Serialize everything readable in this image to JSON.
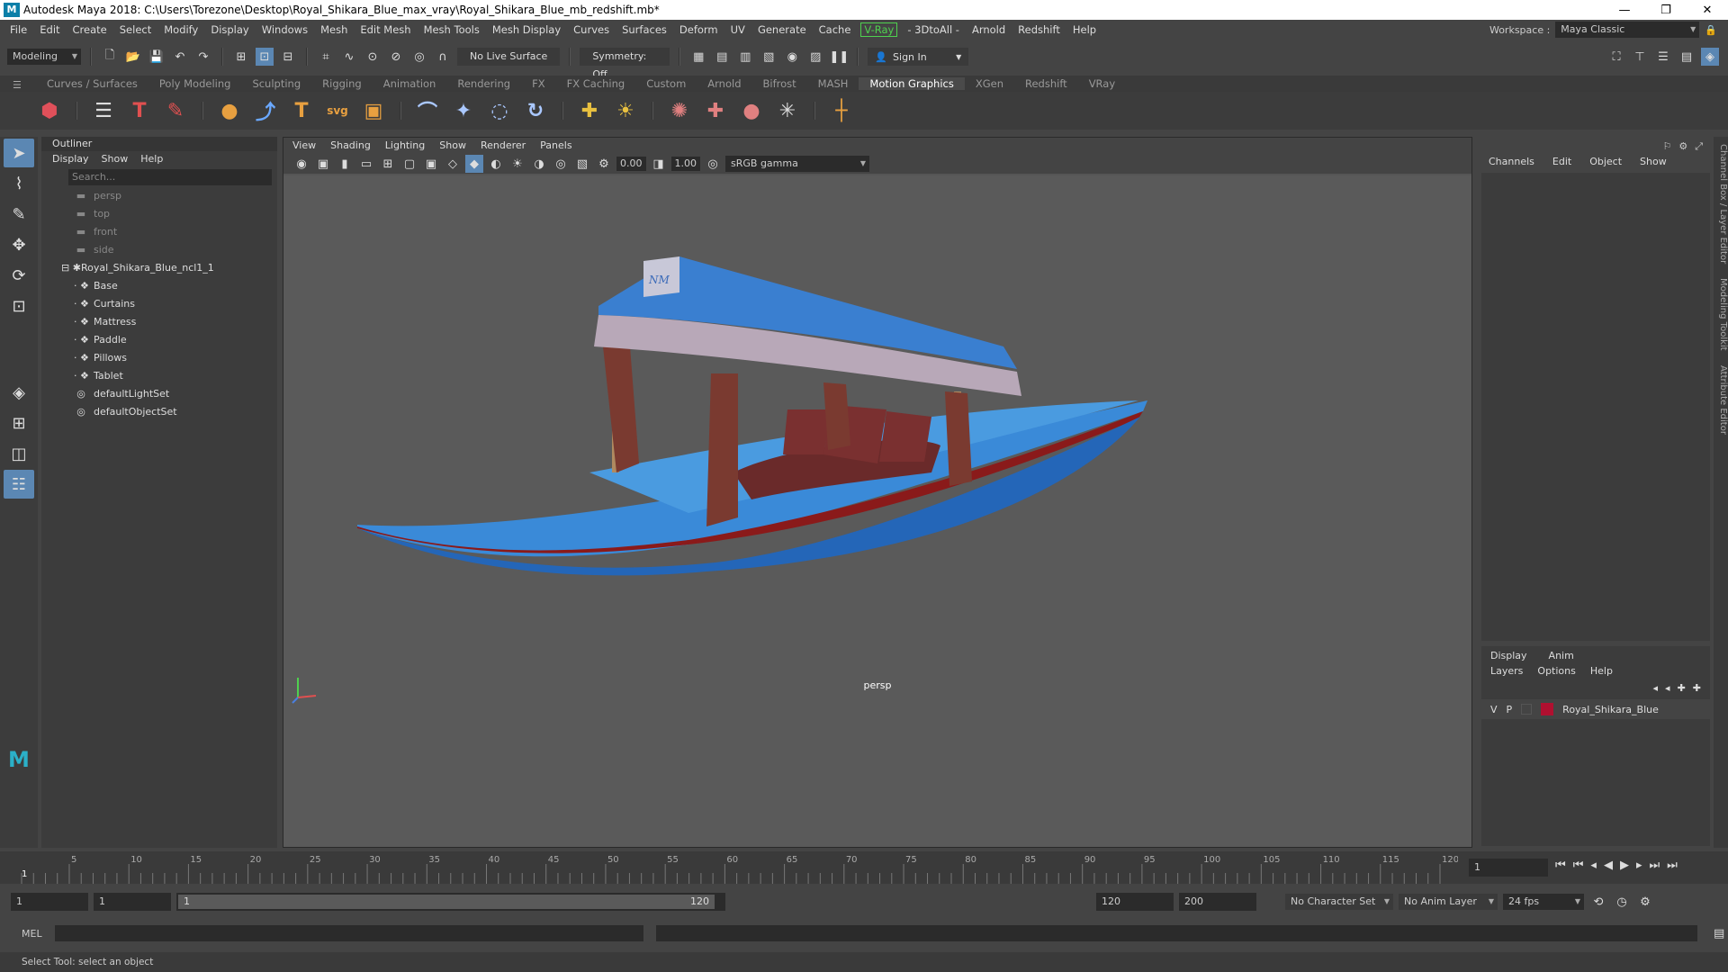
{
  "window": {
    "title": "Autodesk Maya 2018: C:\\Users\\Torezone\\Desktop\\Royal_Shikara_Blue_max_vray\\Royal_Shikara_Blue_mb_redshift.mb*"
  },
  "menubar": {
    "items": [
      "File",
      "Edit",
      "Create",
      "Select",
      "Modify",
      "Display",
      "Windows",
      "Mesh",
      "Edit Mesh",
      "Mesh Tools",
      "Mesh Display",
      "Curves",
      "Surfaces",
      "Deform",
      "UV",
      "Generate",
      "Cache"
    ],
    "vray": "V-Ray",
    "items2": [
      "- 3DtoAll -",
      "Arnold",
      "Redshift",
      "Help"
    ],
    "workspace_label": "Workspace :",
    "workspace_value": "Maya Classic"
  },
  "statusline": {
    "mode": "Modeling",
    "live_surface": "No Live Surface",
    "symmetry": "Symmetry: Off",
    "sign_in": "Sign In"
  },
  "shelf": {
    "tabs": [
      "Curves / Surfaces",
      "Poly Modeling",
      "Sculpting",
      "Rigging",
      "Animation",
      "Rendering",
      "FX",
      "FX Caching",
      "Custom",
      "Arnold",
      "Bifrost",
      "MASH",
      "Motion Graphics",
      "XGen",
      "Redshift",
      "VRay"
    ],
    "active_tab": "Motion Graphics"
  },
  "outliner": {
    "title": "Outliner",
    "menu": [
      "Display",
      "Show",
      "Help"
    ],
    "search_placeholder": "Search...",
    "cameras": [
      "persp",
      "top",
      "front",
      "side"
    ],
    "group": "Royal_Shikara_Blue_ncl1_1",
    "children": [
      "Base",
      "Curtains",
      "Mattress",
      "Paddle",
      "Pillows",
      "Tablet"
    ],
    "sets": [
      "defaultLightSet",
      "defaultObjectSet"
    ]
  },
  "viewport": {
    "menu": [
      "View",
      "Shading",
      "Lighting",
      "Show",
      "Renderer",
      "Panels"
    ],
    "near": "0.00",
    "far": "1.00",
    "color_mgmt": "sRGB gamma",
    "camera_label": "persp"
  },
  "channelbox": {
    "menu": [
      "Channels",
      "Edit",
      "Object",
      "Show"
    ],
    "side_tabs": [
      "Channel Box / Layer Editor",
      "Modeling Toolkit",
      "Attribute Editor"
    ]
  },
  "layers": {
    "tabs": [
      "Display",
      "Anim"
    ],
    "menu": [
      "Layers",
      "Options",
      "Help"
    ],
    "layer_v": "V",
    "layer_p": "P",
    "layer_name": "Royal_Shikara_Blue",
    "layer_color": "#b01030"
  },
  "timeline": {
    "ticks": [
      "5",
      "10",
      "15",
      "20",
      "25",
      "30",
      "35",
      "40",
      "45",
      "50",
      "55",
      "60",
      "65",
      "70",
      "75",
      "80",
      "85",
      "90",
      "95",
      "100",
      "105",
      "110",
      "115",
      "120"
    ],
    "start_tick": "1",
    "current_frame": "1"
  },
  "range": {
    "start": "1",
    "playback_start": "1",
    "slider_start": "1",
    "slider_end": "120",
    "playback_end": "120",
    "end": "200",
    "character_set": "No Character Set",
    "anim_layer": "No Anim Layer",
    "fps": "24 fps"
  },
  "mel": {
    "label": "MEL"
  },
  "help": {
    "text": "Select Tool: select an object"
  },
  "colors": {
    "accent": "#5b87b3",
    "boat_blue": "#2f7fd0"
  }
}
